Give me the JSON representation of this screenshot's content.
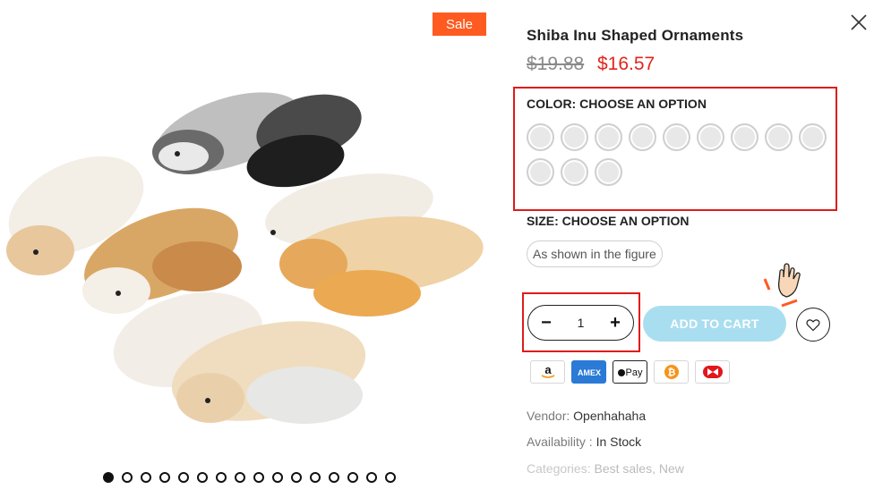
{
  "gallery": {
    "sale_badge": "Sale",
    "slide_count": 16,
    "active_slide": 1
  },
  "product": {
    "title": "Shiba Inu Shaped Ornaments",
    "price_old": "$19.88",
    "price_new": "$16.57",
    "color_label": "COLOR: CHOOSE AN OPTION",
    "color_swatch_count": 12,
    "size_label": "SIZE: CHOOSE AN OPTION",
    "size_option": "As shown in the figure",
    "quantity": "1",
    "minus": "−",
    "plus": "+",
    "add_to_cart": "ADD TO CART",
    "vendor_key": "Vendor:",
    "vendor_value": "Openhahaha",
    "availability_key": "Availability :",
    "availability_value": "In Stock",
    "categories_key": "Categories:",
    "categories_value": "Best sales, New"
  },
  "payments": [
    "amazon-icon",
    "amex-icon",
    "apple-pay-icon",
    "bitcoin-icon",
    "dankort-icon"
  ],
  "colors": {
    "sale": "#ff5a1f",
    "price_new": "#e0261c",
    "highlight_box": "#e01a1a",
    "add_to_cart_bg": "#a9def0"
  }
}
